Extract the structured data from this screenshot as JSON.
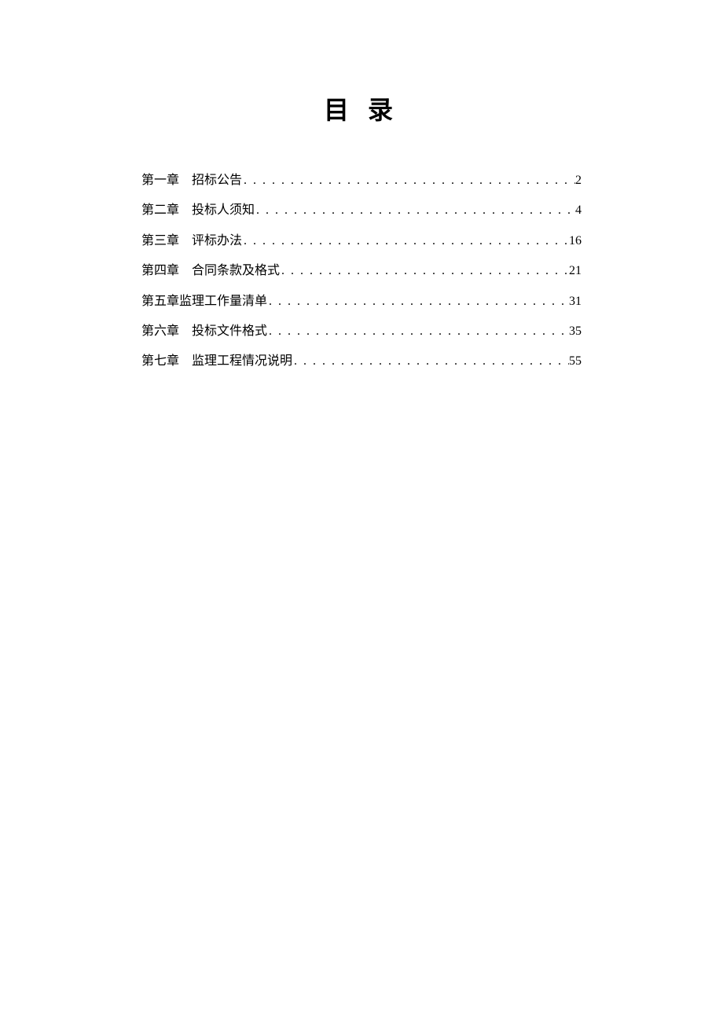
{
  "title": "目 录",
  "toc": {
    "entries": [
      {
        "chapter": "第一章",
        "sep": "　",
        "name": "招标公告",
        "page": "2"
      },
      {
        "chapter": "第二章",
        "sep": "　",
        "name": "投标人须知",
        "page": "4"
      },
      {
        "chapter": "第三章",
        "sep": "　",
        "name": "评标办法",
        "page": "16"
      },
      {
        "chapter": "第四章",
        "sep": "　",
        "name": "合同条款及格式",
        "page": "21"
      },
      {
        "chapter": "第五章",
        "sep": " ",
        "name": "监理工作量清单",
        "page": "31"
      },
      {
        "chapter": "第六章",
        "sep": "　",
        "name": "投标文件格式",
        "page": "35"
      },
      {
        "chapter": "第七章",
        "sep": "　",
        "name": "监理工程情况说明",
        "page": "55"
      }
    ]
  }
}
